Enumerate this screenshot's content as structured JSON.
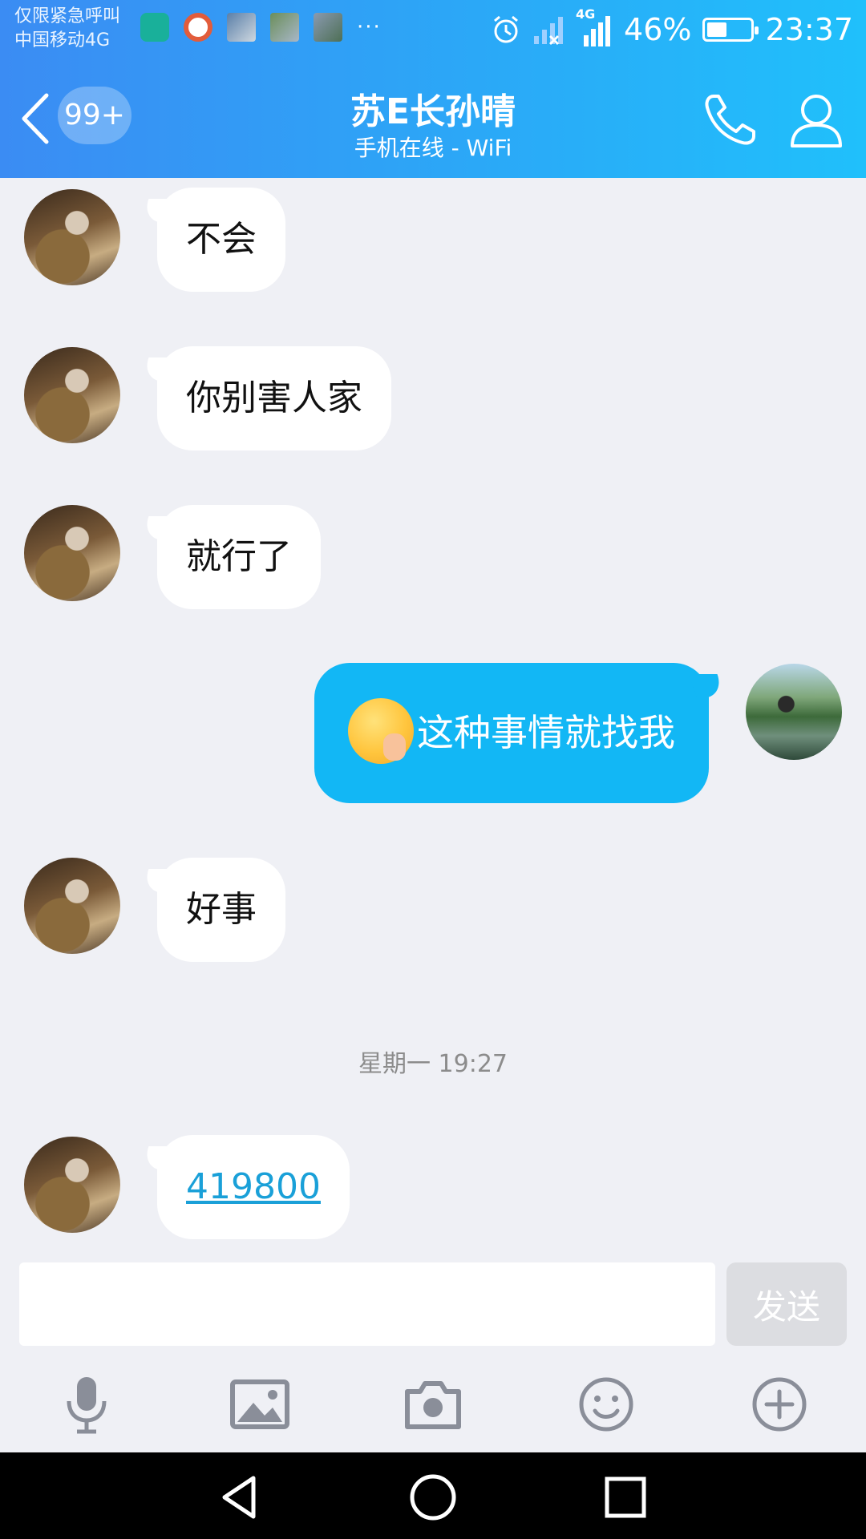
{
  "status_bar": {
    "carrier_line1": "仅限紧急呼叫",
    "carrier_line2": "中国移动4G",
    "more_indicator": "···",
    "network_label": "4G",
    "battery_percent": "46%",
    "battery_level": 0.46,
    "time": "23:37"
  },
  "header": {
    "unread_count": "99+",
    "contact_name": "苏E长孙晴",
    "online_status": "手机在线 - WiFi"
  },
  "messages": [
    {
      "sender": "friend",
      "text": "不会"
    },
    {
      "sender": "friend",
      "text": "你别害人家"
    },
    {
      "sender": "friend",
      "text": "就行了"
    },
    {
      "sender": "me",
      "text": "这种事情就找我",
      "emoji": "smirk-emoji"
    },
    {
      "sender": "friend",
      "text": "好事"
    },
    {
      "type": "timestamp",
      "text": "星期一 19:27"
    },
    {
      "sender": "friend",
      "text": "419800",
      "link": true
    }
  ],
  "input": {
    "value": "",
    "placeholder": "",
    "send_label": "发送"
  },
  "toolbar": [
    "microphone-icon",
    "image-icon",
    "camera-icon",
    "emoji-icon",
    "plus-icon"
  ],
  "colors": {
    "header_gradient_start": "#3b8cf3",
    "header_gradient_end": "#20c0fb",
    "my_bubble": "#12b7f5",
    "link": "#1aa0d8",
    "background": "#eff0f5"
  }
}
